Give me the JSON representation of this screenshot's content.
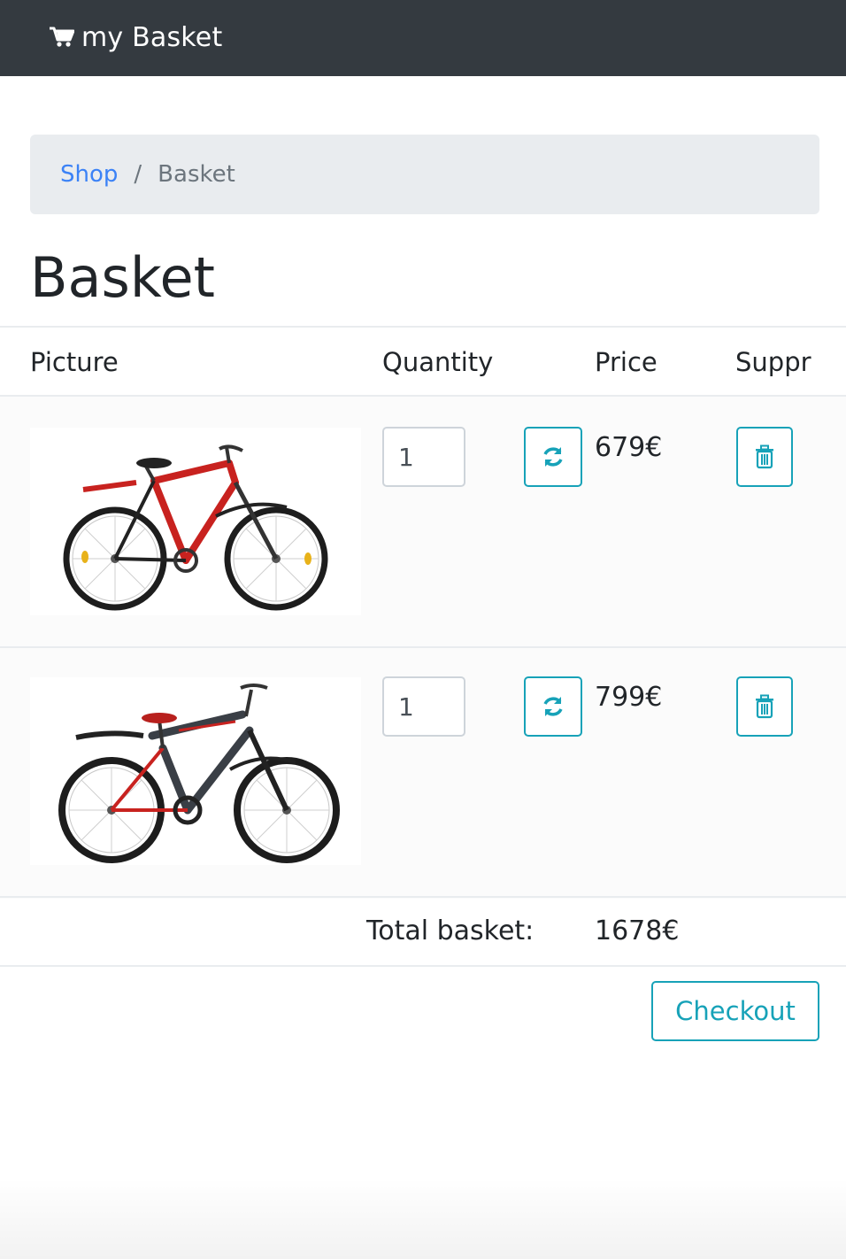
{
  "navbar": {
    "brand": "my Basket",
    "brand_icon": "cart-icon"
  },
  "breadcrumb": {
    "link": "Shop",
    "separator": "/",
    "active": "Basket"
  },
  "page_title": "Basket",
  "table": {
    "headers": {
      "picture": "Picture",
      "quantity": "Quantity",
      "price": "Price",
      "delete": "Suppr"
    },
    "rows": [
      {
        "image": "red-bicycle-image",
        "quantity": "1",
        "price": "679€",
        "refresh_icon": "refresh-icon",
        "delete_icon": "trash-icon"
      },
      {
        "image": "black-red-bicycle-image",
        "quantity": "1",
        "price": "799€",
        "refresh_icon": "refresh-icon",
        "delete_icon": "trash-icon"
      }
    ],
    "total_label": "Total basket:",
    "total_value": "1678€"
  },
  "checkout_label": "Checkout",
  "colors": {
    "navbar": "#343a40",
    "accent": "#17a2b8",
    "link": "#3b82f6",
    "breadcrumb_bg": "#e9ecef"
  }
}
